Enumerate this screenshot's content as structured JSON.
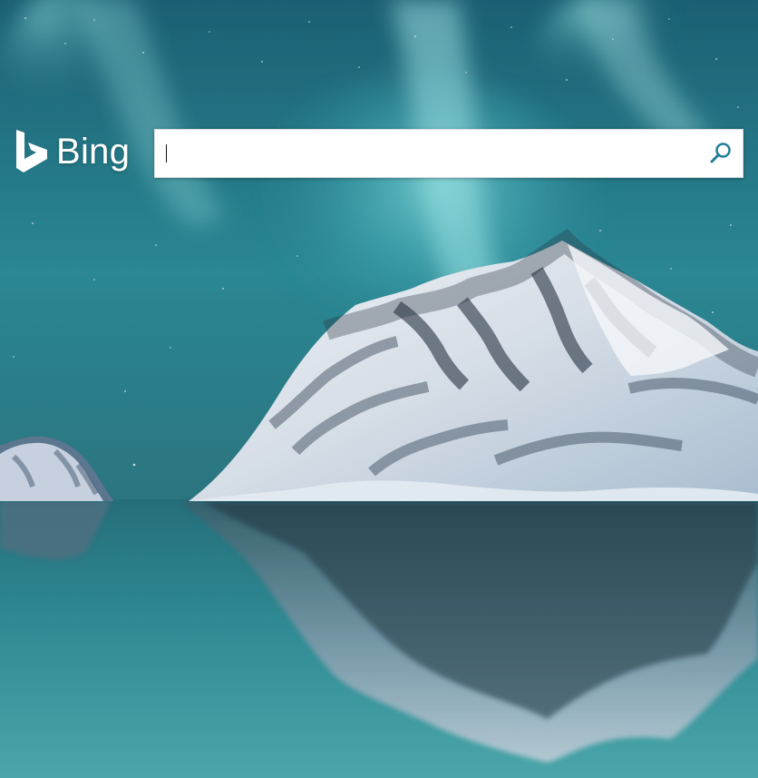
{
  "logo": {
    "text": "Bing",
    "icon": "bing-b-logo-icon",
    "color": "#ffffff"
  },
  "search": {
    "value": "",
    "placeholder": "",
    "icon": "search-icon",
    "icon_color": "#1f7d9b"
  },
  "background": {
    "subject": "aurora-over-snowy-mountain-reflected-in-lake"
  },
  "colors": {
    "sky_top": "#1e6c7f",
    "aurora": "#77d4d8",
    "water": "#2a8a95",
    "snow": "#e8eef3"
  }
}
